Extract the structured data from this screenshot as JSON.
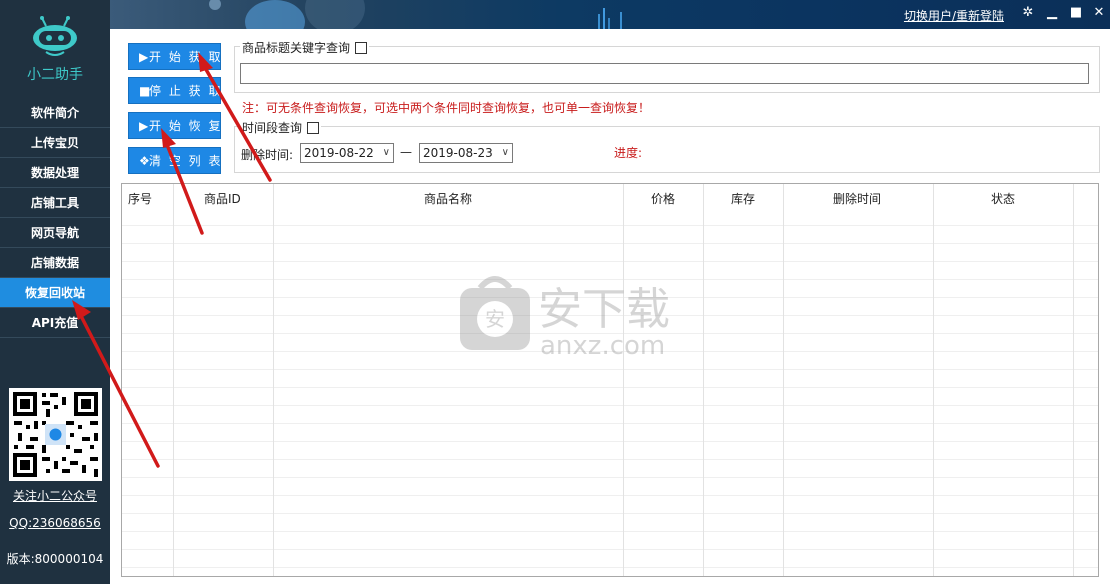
{
  "sidebar": {
    "brand": "小二助手",
    "menu": [
      "软件简介",
      "上传宝贝",
      "数据处理",
      "店铺工具",
      "网页导航",
      "店铺数据",
      "恢复回收站",
      "API充值"
    ],
    "active_index": 6,
    "follow_link": "关注小二公众号",
    "qq": "QQ:236068656",
    "version": "版本:800000104"
  },
  "header": {
    "switch_user": "切换用户/重新登陆",
    "min_icon": "minimize-icon",
    "max_icon": "maximize-icon",
    "close_icon": "close-icon"
  },
  "toolbar": {
    "start_fetch": "开 始 获 取",
    "stop_fetch": "停 止 获 取",
    "start_restore": "开 始 恢 复",
    "clear_list": "清 空 列 表"
  },
  "keyword_query": {
    "title": "商品标题关键字查询",
    "value": ""
  },
  "note": "注：可无条件查询恢复，可选中两个条件同时查询恢复，也可单一查询恢复！",
  "time_query": {
    "title": "时间段查询",
    "delete_time_label": "删除时间:",
    "start_date": "2019-08-22",
    "separator": "—",
    "end_date": "2019-08-23",
    "progress_label": "进度:"
  },
  "table": {
    "columns": [
      "序号",
      "商品ID",
      "商品名称",
      "价格",
      "库存",
      "删除时间",
      "状态"
    ],
    "rows": []
  },
  "watermark": {
    "cn": "安下载",
    "en": "anxz.com"
  },
  "colors": {
    "sidebar_bg": "#1f3140",
    "accent": "#1e88e5",
    "warning": "#c81b1b"
  }
}
